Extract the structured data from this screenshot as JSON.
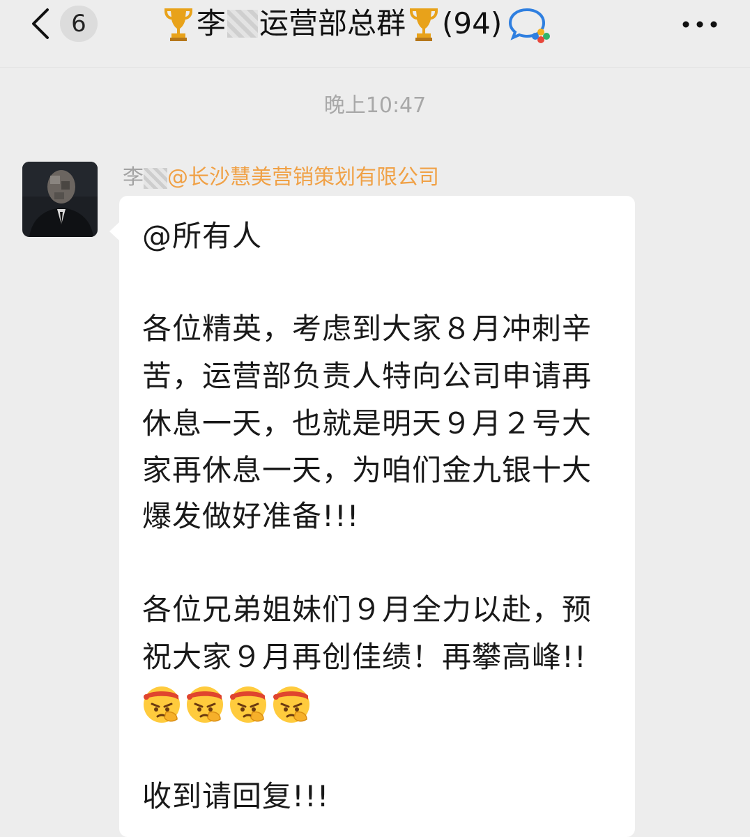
{
  "header": {
    "unread_count": "6",
    "title_part1": "李",
    "title_part2": "运营部总群",
    "member_count": "(94)",
    "back_icon": "chevron-left-icon",
    "more_icon": "more-dots-icon",
    "trophy_icon": "trophy-emoji",
    "app_badge_icon": "wecom-chat-icon"
  },
  "chat": {
    "timestamp": "晚上10:47"
  },
  "message": {
    "sender_name": "李",
    "sender_company": "@长沙慧美营销策划有限公司",
    "lines": [
      "@所有人",
      " 各位精英，考虑到大家８月冲刺辛",
      "苦，运营部负责人特向公司申请再",
      "休息一天，也就是明天９月２号大",
      "家再休息一天，为咱们金九银十大",
      "爆发做好准备!!!",
      "各位兄弟姐妹们９月全力以赴，预",
      "祝大家９月再创佳绩！再攀高峰!!",
      "收到请回复!!!"
    ],
    "emoji_icon": "determined-face-emoji",
    "emoji_count": 4
  },
  "colors": {
    "background": "#ededed",
    "bubble": "#ffffff",
    "company_accent": "#f0a146",
    "timestamp": "#a8a8a8"
  }
}
